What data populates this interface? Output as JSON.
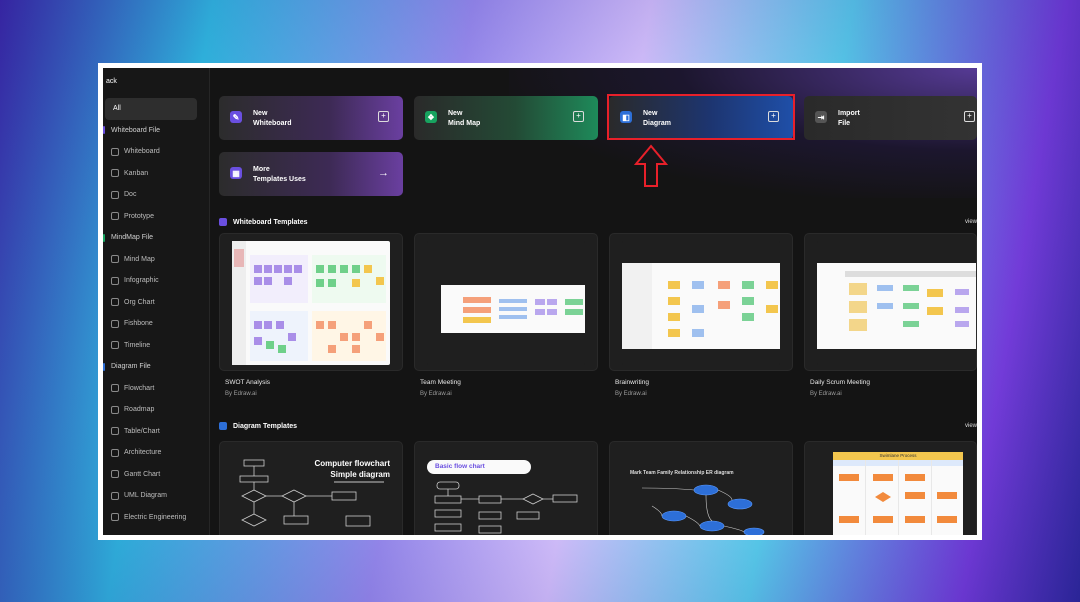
{
  "sidebar": {
    "back_label": "ack",
    "items": [
      {
        "label": "All",
        "kind": "active"
      },
      {
        "label": "Whiteboard File",
        "kind": "section",
        "color": "#6a4fe0"
      },
      {
        "label": "Whiteboard",
        "kind": "item"
      },
      {
        "label": "Kanban",
        "kind": "item"
      },
      {
        "label": "Doc",
        "kind": "item"
      },
      {
        "label": "Prototype",
        "kind": "item"
      },
      {
        "label": "MindMap File",
        "kind": "section",
        "color": "#17a35f"
      },
      {
        "label": "Mind Map",
        "kind": "item"
      },
      {
        "label": "Infographic",
        "kind": "item"
      },
      {
        "label": "Org Chart",
        "kind": "item"
      },
      {
        "label": "Fishbone",
        "kind": "item"
      },
      {
        "label": "Timeline",
        "kind": "item"
      },
      {
        "label": "Diagram File",
        "kind": "section",
        "color": "#2d6fd8"
      },
      {
        "label": "Flowchart",
        "kind": "item"
      },
      {
        "label": "Roadmap",
        "kind": "item"
      },
      {
        "label": "Table/Chart",
        "kind": "item"
      },
      {
        "label": "Architecture",
        "kind": "item"
      },
      {
        "label": "Gantt Chart",
        "kind": "item"
      },
      {
        "label": "UML Diagram",
        "kind": "item"
      },
      {
        "label": "Electric Engineering",
        "kind": "item"
      }
    ]
  },
  "create": {
    "whiteboard": {
      "line1": "New",
      "line2": "Whiteboard",
      "icon": "pen-icon"
    },
    "mindmap": {
      "line1": "New",
      "line2": "Mind Map",
      "icon": "mindmap-icon"
    },
    "diagram": {
      "line1": "New",
      "line2": "Diagram",
      "icon": "diagram-icon"
    },
    "import": {
      "line1": "Import",
      "line2": "File",
      "icon": "import-icon"
    },
    "templates": {
      "line1": "More",
      "line2": "Templates Uses",
      "icon": "template-icon"
    }
  },
  "whiteboard_templates": {
    "title": "Whiteboard Templates",
    "view_all": "view",
    "items": [
      {
        "name": "SWOT Analysis",
        "by": "By Edraw.ai"
      },
      {
        "name": "Team Meeting",
        "by": "By Edraw.ai"
      },
      {
        "name": "Brainwriting",
        "by": "By Edraw.ai"
      },
      {
        "name": "Daily Scrum Meeting",
        "by": "By Edraw.ai"
      }
    ]
  },
  "diagram_templates": {
    "title": "Diagram Templates",
    "view_all": "view",
    "thumb1_title_a": "Computer flowchart",
    "thumb1_title_b": "Simple diagram",
    "thumb2_title": "Basic flow chart",
    "thumb3_title": "Mark Team Family Relationship ER diagram",
    "thumb4_title": "Swimlane Process"
  },
  "colors": {
    "highlight": "#e8202a",
    "accent": "#6a4fe0"
  }
}
